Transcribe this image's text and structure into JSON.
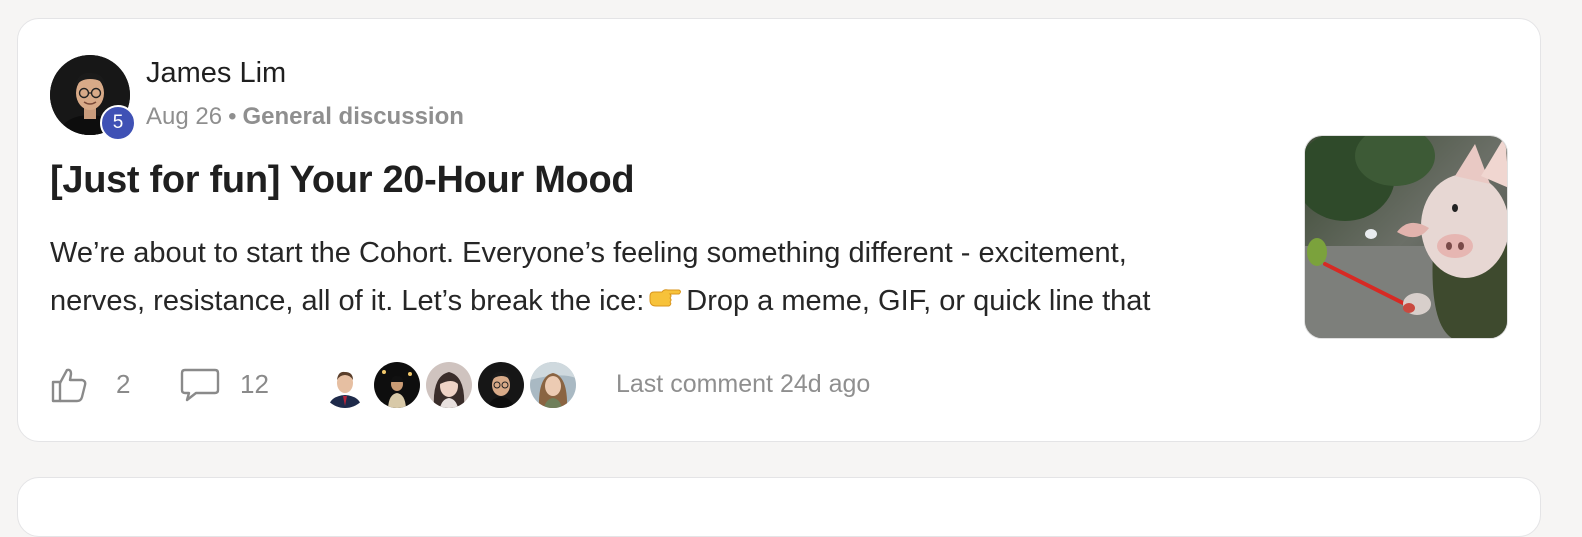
{
  "post": {
    "author_name": "James Lim",
    "author_level": "5",
    "date": "Aug 26",
    "separator": "•",
    "category": "General discussion",
    "title": "[Just for fun] Your 20-Hour Mood",
    "body_line1": "We’re about to start the Cohort. Everyone’s feeling something different - excitement,",
    "body_line2_before_emoji": "nerves, resistance, all of it. Let’s break the ice:",
    "body_line2_emoji": "👉",
    "body_line2_after_emoji": "Drop a meme, GIF, or quick line that",
    "thumbnail_icon": "pig-gif-thumbnail"
  },
  "footer": {
    "like_icon": "thumbs-up-icon",
    "like_count": "2",
    "comment_icon": "speech-bubble-icon",
    "comment_count": "12",
    "participants": [
      {
        "icon": "participant-avatar"
      },
      {
        "icon": "participant-avatar"
      },
      {
        "icon": "participant-avatar"
      },
      {
        "icon": "participant-avatar"
      },
      {
        "icon": "participant-avatar"
      }
    ],
    "last_comment": "Last comment 24d ago"
  },
  "colors": {
    "page_background": "#f6f5f4",
    "card_background": "#ffffff",
    "badge": "#3f51b5",
    "muted_text": "#8f8f8f",
    "title_text": "#1f1f1f"
  }
}
